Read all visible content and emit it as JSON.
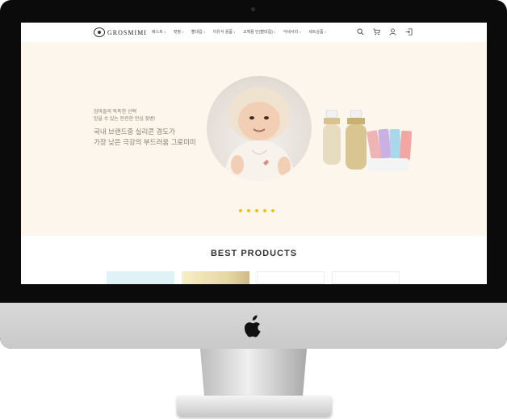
{
  "site": {
    "logo_text": "GROSMIMI",
    "nav": [
      {
        "label": "베스트"
      },
      {
        "label": "젖병"
      },
      {
        "label": "빨대컵"
      },
      {
        "label": "이유식 용품"
      },
      {
        "label": "교체용 빈(빨대컵)"
      },
      {
        "label": "악세서리"
      },
      {
        "label": "세트상품"
      }
    ],
    "header_icons": [
      "search-icon",
      "cart-icon",
      "user-icon",
      "login-icon"
    ]
  },
  "hero": {
    "small_lines": [
      "엄마들의 똑똑한 선택",
      "믿을 수 있는 안전한 안심 젖병!"
    ],
    "big_lines": [
      "국내 브랜드중 실리콘 경도가",
      "가장 낮은 극강의 부드러움 그로미미"
    ],
    "slide_count": 5
  },
  "best_products": {
    "title": "BEST  PRODUCTS"
  },
  "colors": {
    "hero_bg": "#fcf6ec",
    "hero_text": "#8a7d6c",
    "dot": "#f5c300"
  }
}
